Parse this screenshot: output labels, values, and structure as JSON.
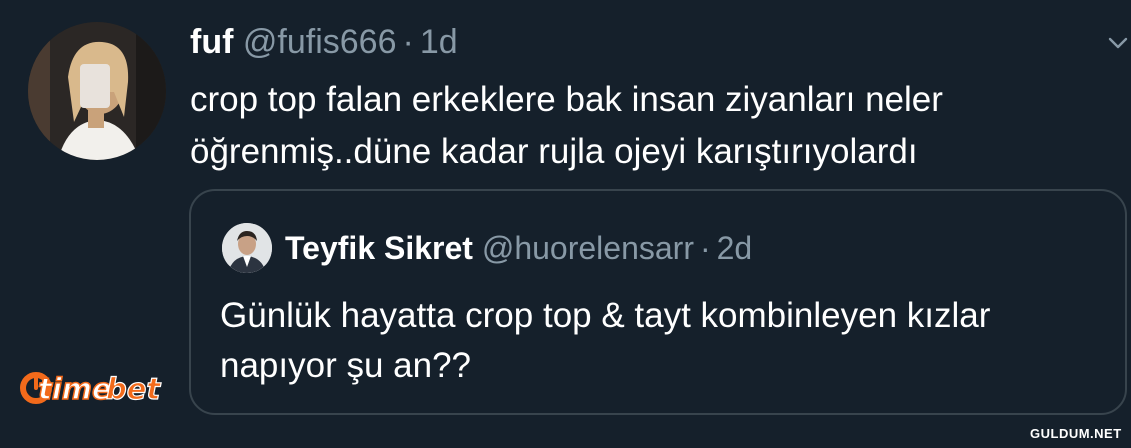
{
  "tweet": {
    "author": {
      "display_name": "fuf",
      "handle": "@fufis666",
      "separator": "·",
      "time": "1d"
    },
    "text_lines": [
      "crop top falan erkeklere bak insan ziyanları neler",
      "öğrenmiş..düne kadar rujla ojeyi karıştırıyolardı"
    ],
    "menu_icon": "chevron-down-icon"
  },
  "quoted_tweet": {
    "author": {
      "display_name": "Teyfik Sikret",
      "handle": "@huorelensarr",
      "separator": "·",
      "time": "2d"
    },
    "text_lines": [
      "Günlük hayatta crop top & tayt kombinleyen kızlar",
      "napıyor şu an??"
    ]
  },
  "watermarks": {
    "logo": "timebet",
    "site": "GULDUM.NET"
  },
  "colors": {
    "background": "#15202b",
    "text_primary": "#ffffff",
    "text_secondary": "#8899a6",
    "border": "#38444d",
    "logo_orange": "#f26a1b"
  }
}
